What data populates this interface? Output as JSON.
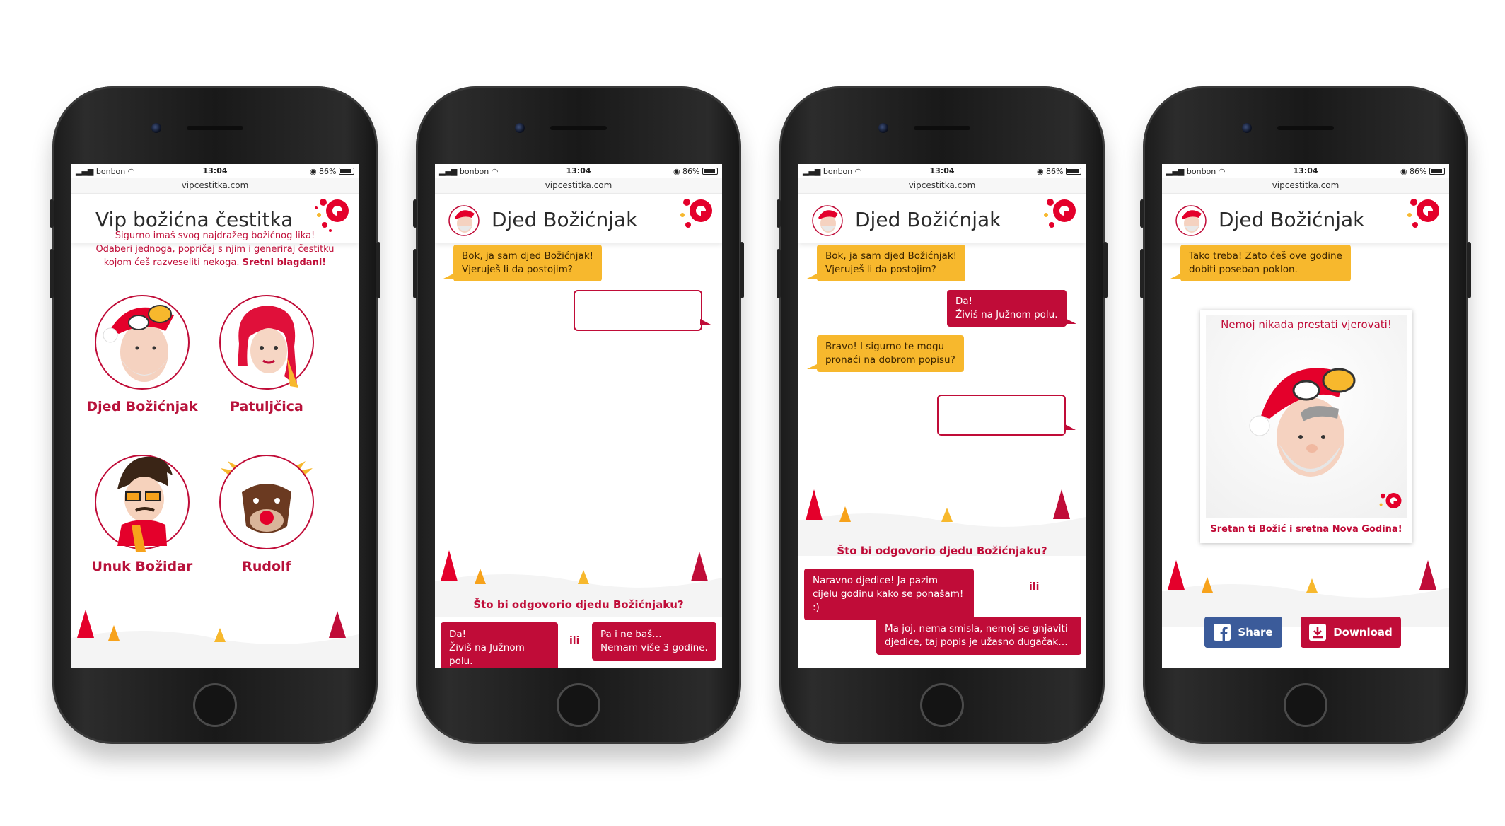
{
  "status": {
    "carrier": "bonbon",
    "time": "13:04",
    "battery": "86%",
    "url": "vipcestitka.com"
  },
  "screen1": {
    "title": "Vip božićna čestitka",
    "intro_lines": [
      "Sigurno imaš svog najdražeg božićnog lika!",
      "Odaberi jednoga, popričaj s njim i generiraj čestitku",
      "kojom ćeš razveseliti nekoga."
    ],
    "intro_bold": "Sretni blagdani!",
    "characters": [
      "Djed Božićnjak",
      "Patuljčica",
      "Unuk Božidar",
      "Rudolf"
    ]
  },
  "chat": {
    "title": "Djed Božićnjak",
    "santa_msg1": [
      "Bok, ja sam djed Božićnjak!",
      "Vjeruješ li da postojim?"
    ],
    "user_reply1": [
      "Da!",
      "Živiš na Južnom polu."
    ],
    "santa_msg2": [
      "Bravo! I sigurno te mogu",
      "pronaći na dobrom popisu?"
    ],
    "question": "Što bi odgovorio djedu Božićnjaku?",
    "or_label": "ili",
    "options_q1": [
      [
        "Da!",
        "Živiš na Južnom polu."
      ],
      [
        "Pa i ne baš…",
        "Nemam više 3 godine."
      ]
    ],
    "options_q2": [
      [
        "Naravno djedice! Ja pazim",
        "cijelu godinu kako se ponašam! :)"
      ],
      [
        "Ma joj, nema smisla, nemoj se gnjaviti",
        "djedice, taj popis je užasno dugačak…"
      ]
    ]
  },
  "result": {
    "santa_msg": [
      "Tako treba! Zato ćeš ove godine",
      "dobiti poseban poklon."
    ],
    "card_top": "Nemoj nikada prestati vjerovati!",
    "card_bottom": "Sretan ti Božić i sretna Nova Godina!",
    "share_label": "Share",
    "download_label": "Download"
  },
  "colors": {
    "brand_red": "#c00c38",
    "santa_bubble": "#f7b82d",
    "facebook_blue": "#3b5b9a"
  }
}
